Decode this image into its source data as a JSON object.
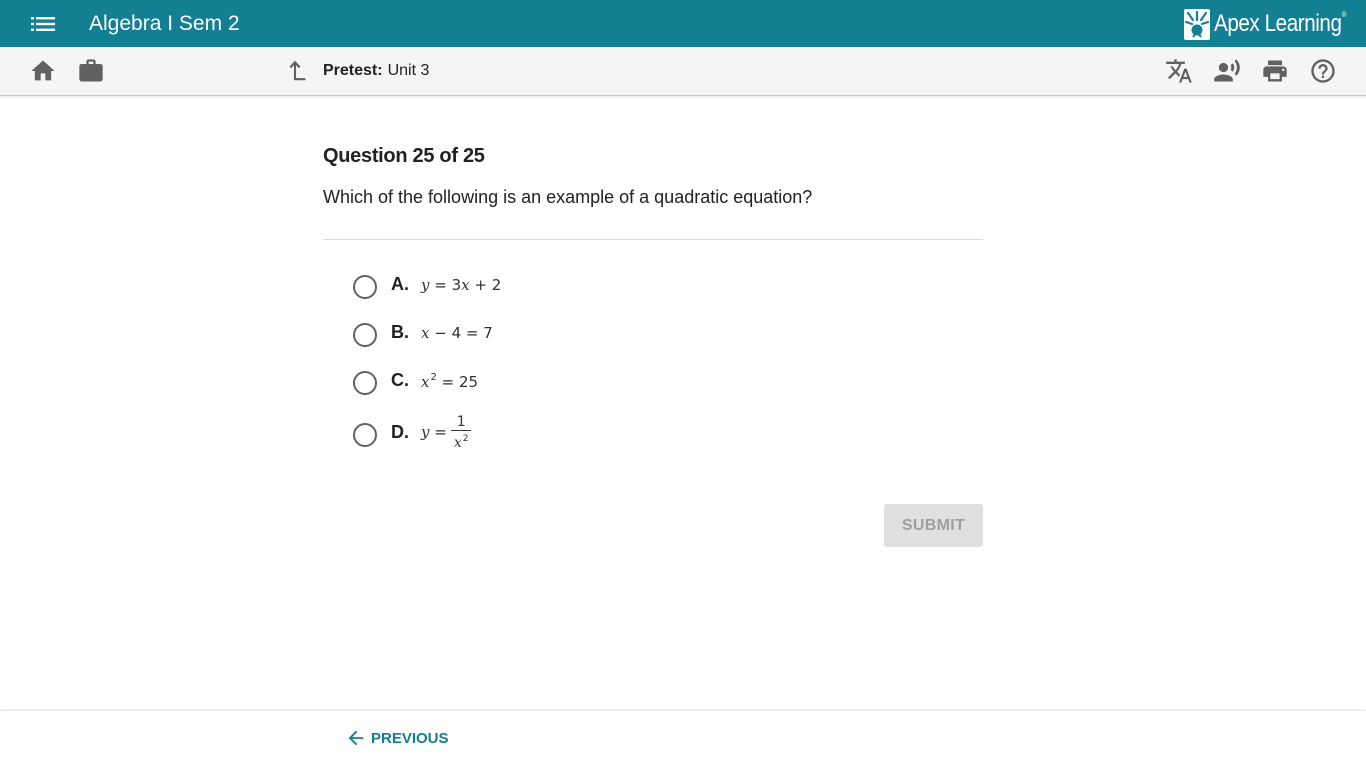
{
  "header": {
    "course_title": "Algebra I Sem 2",
    "brand_name": "Apex Learning",
    "brand_tm": "®"
  },
  "toolbar": {
    "breadcrumb_label": "Pretest:",
    "breadcrumb_value": "Unit 3"
  },
  "question": {
    "number_text": "Question 25 of 25",
    "prompt": "Which of the following is an example of a quadratic equation?",
    "options": [
      {
        "letter": "A.",
        "expression": "y = 3x + 2",
        "selected": false
      },
      {
        "letter": "B.",
        "expression": "x − 4 = 7",
        "selected": false
      },
      {
        "letter": "C.",
        "expression": "x² = 25",
        "selected": false
      },
      {
        "letter": "D.",
        "expression": "y = 1/x²",
        "selected": false
      }
    ]
  },
  "actions": {
    "submit_label": "SUBMIT",
    "submit_enabled": false
  },
  "footer": {
    "previous_label": "PREVIOUS"
  },
  "colors": {
    "brand": "#127f93",
    "toolbar_bg": "#f5f5f5",
    "submit_disabled_bg": "#e0e0e0",
    "submit_disabled_text": "#9e9e9e"
  },
  "icons": {
    "menu": "menu-icon",
    "home": "home-icon",
    "briefcase": "briefcase-icon",
    "up": "up-arrow-icon",
    "translate": "translate-icon",
    "speak": "text-to-speech-icon",
    "print": "print-icon",
    "help": "help-icon",
    "previous": "arrow-left-icon"
  }
}
